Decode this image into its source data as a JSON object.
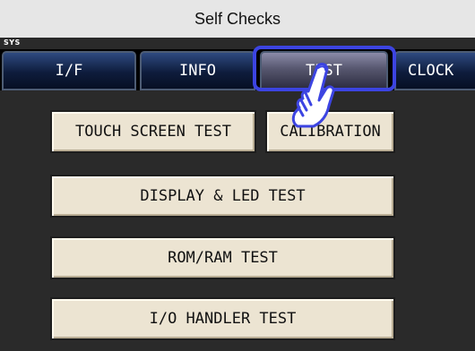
{
  "window": {
    "title": "Self Checks"
  },
  "screen": {
    "mode_label": "SYS"
  },
  "tabs": [
    {
      "label": "I/F",
      "active": false
    },
    {
      "label": "INFO",
      "active": false
    },
    {
      "label": "TEST",
      "active": true
    },
    {
      "label": "CLOCK",
      "active": false
    }
  ],
  "buttons": {
    "touch_screen_test": "TOUCH SCREEN TEST",
    "calibration": "CALIBRATION",
    "display_led_test": "DISPLAY & LED TEST",
    "rom_ram_test": "ROM/RAM TEST",
    "io_handler_test": "I/O HANDLER TEST"
  },
  "colors": {
    "focus_ring": "#3c44e2",
    "button_face": "#ece4d2",
    "tab_inactive": "#0e1c3c"
  },
  "pointer": {
    "icon": "tap-finger-icon"
  }
}
